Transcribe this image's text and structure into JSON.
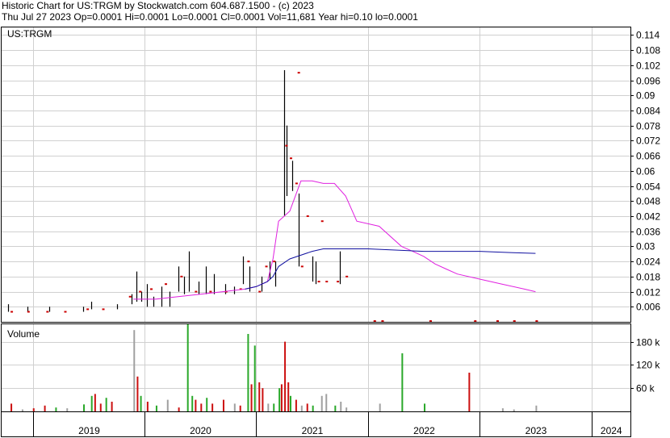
{
  "header": {
    "line1": "Historic Chart for US:TRGM by Stockwatch.com 604.687.1500 - (c) 2023",
    "line2": "Thu Jul 27 2023   Op=0.0001   Hi=0.0001   Lo=0.0001   Cl=0.0001   Vol=11,681   Year hi=0.10   lo=0.0001"
  },
  "colors": {
    "price": "#000000",
    "close_tick": "#cc0000",
    "ma_short": "#e020e0",
    "ma_long": "#1010a0",
    "vol_up": "#2aa82a",
    "vol_down": "#cc1010",
    "vol_flat": "#a0a0a0"
  },
  "chart_data": [
    {
      "type": "line",
      "title": "US:TRGM",
      "ylim": [
        0,
        0.117
      ],
      "y_ticks": [
        "0.114",
        "0.108",
        "0.102",
        "0.096",
        "0.09",
        "0.084",
        "0.078",
        "0.072",
        "0.066",
        "0.06",
        "0.054",
        "0.048",
        "0.042",
        "0.036",
        "0.03",
        "0.024",
        "0.018",
        "0.012",
        "0.006"
      ],
      "x_ticks": [
        "2019",
        "2020",
        "2021",
        "2022",
        "2023",
        "2024"
      ],
      "grid": true,
      "bars": [
        {
          "x": 2018.78,
          "hi": 0.007,
          "lo": 0.004
        },
        {
          "x": 2018.95,
          "hi": 0.006,
          "lo": 0.004
        },
        {
          "x": 2019.15,
          "hi": 0.006,
          "lo": 0.004
        },
        {
          "x": 2019.45,
          "hi": 0.006,
          "lo": 0.004
        },
        {
          "x": 2019.52,
          "hi": 0.008,
          "lo": 0.005
        },
        {
          "x": 2019.75,
          "hi": 0.007,
          "lo": 0.005
        },
        {
          "x": 2019.88,
          "hi": 0.011,
          "lo": 0.007
        },
        {
          "x": 2019.93,
          "hi": 0.02,
          "lo": 0.008
        },
        {
          "x": 2019.97,
          "hi": 0.012,
          "lo": 0.008
        },
        {
          "x": 2020.02,
          "hi": 0.015,
          "lo": 0.006
        },
        {
          "x": 2020.08,
          "hi": 0.01,
          "lo": 0.006
        },
        {
          "x": 2020.15,
          "hi": 0.014,
          "lo": 0.006
        },
        {
          "x": 2020.22,
          "hi": 0.012,
          "lo": 0.006
        },
        {
          "x": 2020.3,
          "hi": 0.022,
          "lo": 0.012
        },
        {
          "x": 2020.35,
          "hi": 0.018,
          "lo": 0.011
        },
        {
          "x": 2020.4,
          "hi": 0.028,
          "lo": 0.012
        },
        {
          "x": 2020.48,
          "hi": 0.016,
          "lo": 0.011
        },
        {
          "x": 2020.55,
          "hi": 0.022,
          "lo": 0.011
        },
        {
          "x": 2020.62,
          "hi": 0.019,
          "lo": 0.011
        },
        {
          "x": 2020.72,
          "hi": 0.015,
          "lo": 0.011
        },
        {
          "x": 2020.8,
          "hi": 0.014,
          "lo": 0.011
        },
        {
          "x": 2020.88,
          "hi": 0.026,
          "lo": 0.015
        },
        {
          "x": 2020.94,
          "hi": 0.022,
          "lo": 0.012
        },
        {
          "x": 2021.05,
          "hi": 0.018,
          "lo": 0.012
        },
        {
          "x": 2021.12,
          "hi": 0.024,
          "lo": 0.017
        },
        {
          "x": 2021.17,
          "hi": 0.024,
          "lo": 0.014
        },
        {
          "x": 2021.25,
          "hi": 0.1,
          "lo": 0.042
        },
        {
          "x": 2021.27,
          "hi": 0.078,
          "lo": 0.05
        },
        {
          "x": 2021.32,
          "hi": 0.064,
          "lo": 0.052
        },
        {
          "x": 2021.38,
          "hi": 0.051,
          "lo": 0.022
        },
        {
          "x": 2021.5,
          "hi": 0.026,
          "lo": 0.016
        },
        {
          "x": 2021.53,
          "hi": 0.024,
          "lo": 0.015
        },
        {
          "x": 2021.75,
          "hi": 0.028,
          "lo": 0.015
        }
      ],
      "closes": [
        {
          "x": 2018.8,
          "y": 0.004
        },
        {
          "x": 2018.95,
          "y": 0.004
        },
        {
          "x": 2019.12,
          "y": 0.004
        },
        {
          "x": 2019.28,
          "y": 0.004
        },
        {
          "x": 2019.48,
          "y": 0.005
        },
        {
          "x": 2019.62,
          "y": 0.005
        },
        {
          "x": 2019.86,
          "y": 0.01
        },
        {
          "x": 2019.95,
          "y": 0.012
        },
        {
          "x": 2020.05,
          "y": 0.013
        },
        {
          "x": 2020.18,
          "y": 0.015
        },
        {
          "x": 2020.32,
          "y": 0.018
        },
        {
          "x": 2020.45,
          "y": 0.012
        },
        {
          "x": 2020.58,
          "y": 0.012
        },
        {
          "x": 2020.72,
          "y": 0.012
        },
        {
          "x": 2020.85,
          "y": 0.013
        },
        {
          "x": 2020.92,
          "y": 0.024
        },
        {
          "x": 2021.02,
          "y": 0.012
        },
        {
          "x": 2021.08,
          "y": 0.022
        },
        {
          "x": 2021.15,
          "y": 0.024
        },
        {
          "x": 2021.26,
          "y": 0.07
        },
        {
          "x": 2021.3,
          "y": 0.065
        },
        {
          "x": 2021.35,
          "y": 0.055
        },
        {
          "x": 2021.4,
          "y": 0.022
        },
        {
          "x": 2021.45,
          "y": 0.042
        },
        {
          "x": 2021.55,
          "y": 0.016
        },
        {
          "x": 2021.62,
          "y": 0.016
        },
        {
          "x": 2021.72,
          "y": 0.016
        },
        {
          "x": 2021.8,
          "y": 0.018
        },
        {
          "x": 2021.58,
          "y": 0.04
        },
        {
          "x": 2021.37,
          "y": 0.099
        }
      ],
      "low_closes": [
        {
          "x": 2022.05,
          "y": 0.0001
        },
        {
          "x": 2022.12,
          "y": 0.0001
        },
        {
          "x": 2022.55,
          "y": 0.0001
        },
        {
          "x": 2022.95,
          "y": 0.0001
        },
        {
          "x": 2023.15,
          "y": 0.0001
        },
        {
          "x": 2023.3,
          "y": 0.0001
        },
        {
          "x": 2023.5,
          "y": 0.0001
        }
      ],
      "series": [
        {
          "x": [
            2019.9,
            2020.1,
            2020.3,
            2020.5,
            2020.7,
            2020.9,
            2021.0,
            2021.1,
            2021.15,
            2021.2,
            2021.3,
            2021.4,
            2021.5,
            2021.6,
            2021.7,
            2021.8,
            2021.9,
            2022.1,
            2022.3,
            2022.4,
            2022.5,
            2022.6,
            2022.7,
            2022.8,
            2023.0,
            2023.2,
            2023.4,
            2023.5
          ],
          "y": [
            0.009,
            0.009,
            0.01,
            0.011,
            0.012,
            0.013,
            0.014,
            0.016,
            0.025,
            0.04,
            0.044,
            0.056,
            0.056,
            0.055,
            0.055,
            0.05,
            0.04,
            0.038,
            0.03,
            0.028,
            0.026,
            0.023,
            0.021,
            0.019,
            0.017,
            0.015,
            0.013,
            0.012
          ]
        },
        {
          "x": [
            2020.9,
            2021.0,
            2021.1,
            2021.15,
            2021.2,
            2021.3,
            2021.5,
            2021.6,
            2021.7,
            2022.0,
            2022.5,
            2023.0,
            2023.3,
            2023.5
          ],
          "y": [
            0.013,
            0.014,
            0.016,
            0.018,
            0.022,
            0.025,
            0.028,
            0.029,
            0.029,
            0.029,
            0.028,
            0.028,
            0.0275,
            0.0272
          ]
        }
      ]
    },
    {
      "type": "bar",
      "title": "Volume",
      "ylim": [
        0,
        225000
      ],
      "y_ticks": [
        "180 k",
        "120 k",
        "60 k"
      ],
      "x_ticks": [
        "2019",
        "2020",
        "2021",
        "2022",
        "2023",
        "2024"
      ],
      "bars": [
        {
          "x": 2018.8,
          "v": 20000,
          "c": "down"
        },
        {
          "x": 2018.9,
          "v": 5000,
          "c": "flat"
        },
        {
          "x": 2019.0,
          "v": 8000,
          "c": "down"
        },
        {
          "x": 2019.1,
          "v": 15000,
          "c": "down"
        },
        {
          "x": 2019.2,
          "v": 10000,
          "c": "up"
        },
        {
          "x": 2019.3,
          "v": 8000,
          "c": "flat"
        },
        {
          "x": 2019.45,
          "v": 18000,
          "c": "up"
        },
        {
          "x": 2019.52,
          "v": 40000,
          "c": "up"
        },
        {
          "x": 2019.55,
          "v": 45000,
          "c": "down"
        },
        {
          "x": 2019.6,
          "v": 20000,
          "c": "down"
        },
        {
          "x": 2019.65,
          "v": 35000,
          "c": "up"
        },
        {
          "x": 2019.7,
          "v": 25000,
          "c": "down"
        },
        {
          "x": 2019.9,
          "v": 210000,
          "c": "flat"
        },
        {
          "x": 2019.93,
          "v": 90000,
          "c": "down"
        },
        {
          "x": 2019.96,
          "v": 40000,
          "c": "up"
        },
        {
          "x": 2020.02,
          "v": 25000,
          "c": "down"
        },
        {
          "x": 2020.1,
          "v": 15000,
          "c": "up"
        },
        {
          "x": 2020.2,
          "v": 30000,
          "c": "flat"
        },
        {
          "x": 2020.3,
          "v": 10000,
          "c": "down"
        },
        {
          "x": 2020.38,
          "v": 225000,
          "c": "up"
        },
        {
          "x": 2020.42,
          "v": 40000,
          "c": "up"
        },
        {
          "x": 2020.45,
          "v": 30000,
          "c": "down"
        },
        {
          "x": 2020.5,
          "v": 20000,
          "c": "down"
        },
        {
          "x": 2020.55,
          "v": 35000,
          "c": "up"
        },
        {
          "x": 2020.6,
          "v": 20000,
          "c": "down"
        },
        {
          "x": 2020.7,
          "v": 30000,
          "c": "down"
        },
        {
          "x": 2020.8,
          "v": 20000,
          "c": "flat"
        },
        {
          "x": 2020.85,
          "v": 15000,
          "c": "down"
        },
        {
          "x": 2020.92,
          "v": 200000,
          "c": "up"
        },
        {
          "x": 2020.95,
          "v": 70000,
          "c": "down"
        },
        {
          "x": 2020.98,
          "v": 170000,
          "c": "up"
        },
        {
          "x": 2021.02,
          "v": 75000,
          "c": "down"
        },
        {
          "x": 2021.05,
          "v": 60000,
          "c": "down"
        },
        {
          "x": 2021.1,
          "v": 20000,
          "c": "flat"
        },
        {
          "x": 2021.15,
          "v": 20000,
          "c": "up"
        },
        {
          "x": 2021.2,
          "v": 60000,
          "c": "up"
        },
        {
          "x": 2021.22,
          "v": 70000,
          "c": "down"
        },
        {
          "x": 2021.25,
          "v": 180000,
          "c": "down"
        },
        {
          "x": 2021.28,
          "v": 75000,
          "c": "down"
        },
        {
          "x": 2021.3,
          "v": 40000,
          "c": "up"
        },
        {
          "x": 2021.35,
          "v": 30000,
          "c": "down"
        },
        {
          "x": 2021.4,
          "v": 15000,
          "c": "flat"
        },
        {
          "x": 2021.45,
          "v": 20000,
          "c": "down"
        },
        {
          "x": 2021.5,
          "v": 15000,
          "c": "up"
        },
        {
          "x": 2021.58,
          "v": 40000,
          "c": "flat"
        },
        {
          "x": 2021.62,
          "v": 45000,
          "c": "flat"
        },
        {
          "x": 2021.7,
          "v": 15000,
          "c": "up"
        },
        {
          "x": 2021.75,
          "v": 25000,
          "c": "flat"
        },
        {
          "x": 2021.8,
          "v": 10000,
          "c": "flat"
        },
        {
          "x": 2022.1,
          "v": 20000,
          "c": "flat"
        },
        {
          "x": 2022.3,
          "v": 150000,
          "c": "up"
        },
        {
          "x": 2022.5,
          "v": 20000,
          "c": "up"
        },
        {
          "x": 2022.9,
          "v": 100000,
          "c": "down"
        },
        {
          "x": 2023.2,
          "v": 8000,
          "c": "flat"
        },
        {
          "x": 2023.5,
          "v": 15000,
          "c": "flat"
        },
        {
          "x": 2023.3,
          "v": 5000,
          "c": "flat"
        }
      ]
    }
  ]
}
